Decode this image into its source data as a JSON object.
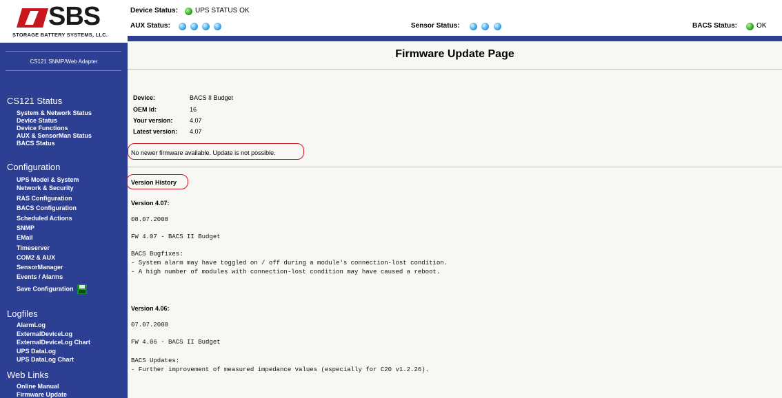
{
  "logo": {
    "brand": "SBS",
    "subtitle": "STORAGE BATTERY SYSTEMS, LLC."
  },
  "adapter": {
    "label": "CS121 SNMP/Web Adapter"
  },
  "sidebar": {
    "sections": [
      {
        "title": "CS121 Status",
        "items": [
          "System & Network Status",
          "Device Status",
          "Device Functions",
          "AUX & SensorMan Status",
          "BACS Status"
        ]
      },
      {
        "title": "Configuration",
        "items": [
          "UPS Model & System",
          "Network & Security",
          "RAS Configuration",
          "BACS Configuration",
          "Scheduled Actions",
          "SNMP",
          "EMail",
          "Timeserver",
          "COM2 & AUX",
          "SensorManager",
          "Events / Alarms",
          "Save Configuration"
        ]
      },
      {
        "title": "Logfiles",
        "items": [
          "AlarmLog",
          "ExternalDeviceLog",
          "ExternalDeviceLog Chart",
          "UPS DataLog",
          "UPS DataLog Chart"
        ]
      },
      {
        "title": "Web Links",
        "items": [
          "Online Manual",
          "Firmware Update"
        ]
      }
    ]
  },
  "status": {
    "device_label": "Device Status:",
    "device_value": "UPS STATUS OK",
    "aux_label": "AUX Status:",
    "sensor_label": "Sensor Status:",
    "bacs_label": "BACS Status:",
    "bacs_value": "OK",
    "colors": {
      "ok": "#2fa61e",
      "idle": "#3aa3e6"
    }
  },
  "main": {
    "title": "Firmware Update Page",
    "info": [
      {
        "label": "Device:",
        "value": "BACS II Budget"
      },
      {
        "label": "OEM Id:",
        "value": "16"
      },
      {
        "label": "Your version:",
        "value": "4.07"
      },
      {
        "label": "Latest version:",
        "value": "4.07"
      }
    ],
    "message": "No newer firmware available. Update is not possible.",
    "version_history_label": "Version History",
    "versions": [
      {
        "heading": "Version 4.07:",
        "date": "08.07.2008",
        "fw": "FW 4.07 - BACS II Budget",
        "notes_title": "BACS Bugfixes:",
        "notes": [
          "- System alarm may have toggled on / off during a module's connection-lost condition.",
          "- A high number of modules with connection-lost condition may have caused a reboot."
        ]
      },
      {
        "heading": "Version 4.06:",
        "date": "07.07.2008",
        "fw": "FW 4.06 - BACS II Budget",
        "notes_title": "BACS Updates:",
        "notes": [
          "- Further improvement of measured impedance values (especially for C20 v1.2.26)."
        ]
      }
    ]
  }
}
